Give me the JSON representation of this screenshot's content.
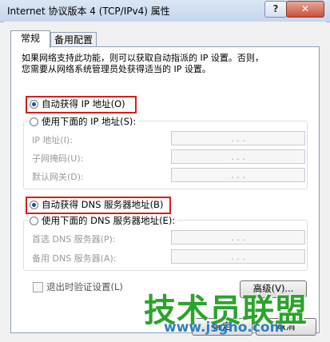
{
  "window": {
    "title": "Internet 协议版本 4 (TCP/IPv4) 属性",
    "help_label": "?",
    "close_label": "✕"
  },
  "tabs": [
    {
      "label": "常规",
      "active": true
    },
    {
      "label": "备用配置",
      "active": false
    }
  ],
  "description_line1": "如果网络支持此功能，则可以获取自动指派的 IP 设置。否则，",
  "description_line2": "您需要从网络系统管理员处获得适当的 IP 设置。",
  "ip": {
    "auto_label": "自动获得 IP 地址(O)",
    "auto_selected": true,
    "manual_label": "使用下面的 IP 地址(S):",
    "fields": [
      {
        "label": "IP 地址(I):",
        "value": ". . ."
      },
      {
        "label": "子网掩码(U):",
        "value": ". . ."
      },
      {
        "label": "默认网关(D):",
        "value": ". . ."
      }
    ]
  },
  "dns": {
    "auto_label": "自动获得 DNS 服务器地址(B)",
    "auto_selected": true,
    "manual_label": "使用下面的 DNS 服务器地址(E):",
    "fields": [
      {
        "label": "首选 DNS 服务器(P):",
        "value": ". . ."
      },
      {
        "label": "备用 DNS 服务器(A):",
        "value": ". . ."
      }
    ]
  },
  "validate_checkbox_label": "退出时验证设置(L)",
  "advanced_button": "高级(V)...",
  "ok_button": "确定",
  "cancel_button": "取消",
  "watermark_text": "技术员联盟",
  "watermark_url": "www.jsgho.com",
  "colors": {
    "highlight": "#d71d1d",
    "watermark": "#2ca32c",
    "radio_dot": "#1d4f9a"
  }
}
